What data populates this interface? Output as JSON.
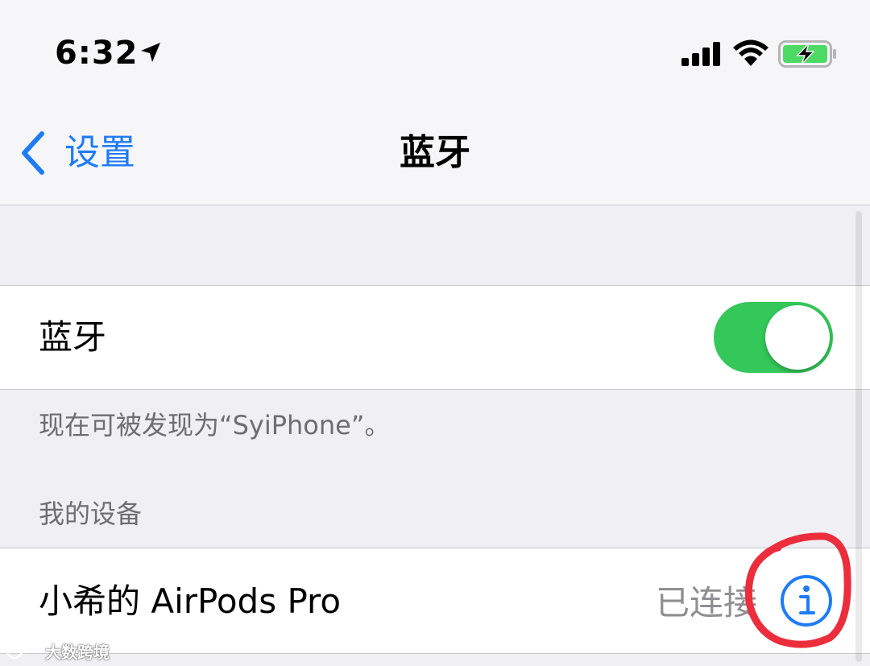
{
  "status_bar": {
    "time": "6:32",
    "icons": [
      "location-arrow-icon",
      "cellular-signal-icon",
      "wifi-icon",
      "battery-charging-icon"
    ],
    "battery_color": "#4cd964"
  },
  "nav": {
    "back_label": "设置",
    "title": "蓝牙"
  },
  "bluetooth": {
    "label": "蓝牙",
    "toggle_on": true,
    "toggle_color": "#34c759",
    "footer": "现在可被发现为“SyiPhone”。"
  },
  "my_devices": {
    "header": "我的设备",
    "devices": [
      {
        "name": "小希的 AirPods Pro",
        "status": "已连接",
        "icon": "info-icon"
      }
    ]
  },
  "annotation": {
    "color": "#ec2d3c",
    "shape": "hand-drawn circle around info icon"
  },
  "watermark": {
    "text": "大数跨境"
  },
  "colors": {
    "accent": "#1f7cf5",
    "background": "#efeff4",
    "secondary_text": "#6d6d72"
  }
}
